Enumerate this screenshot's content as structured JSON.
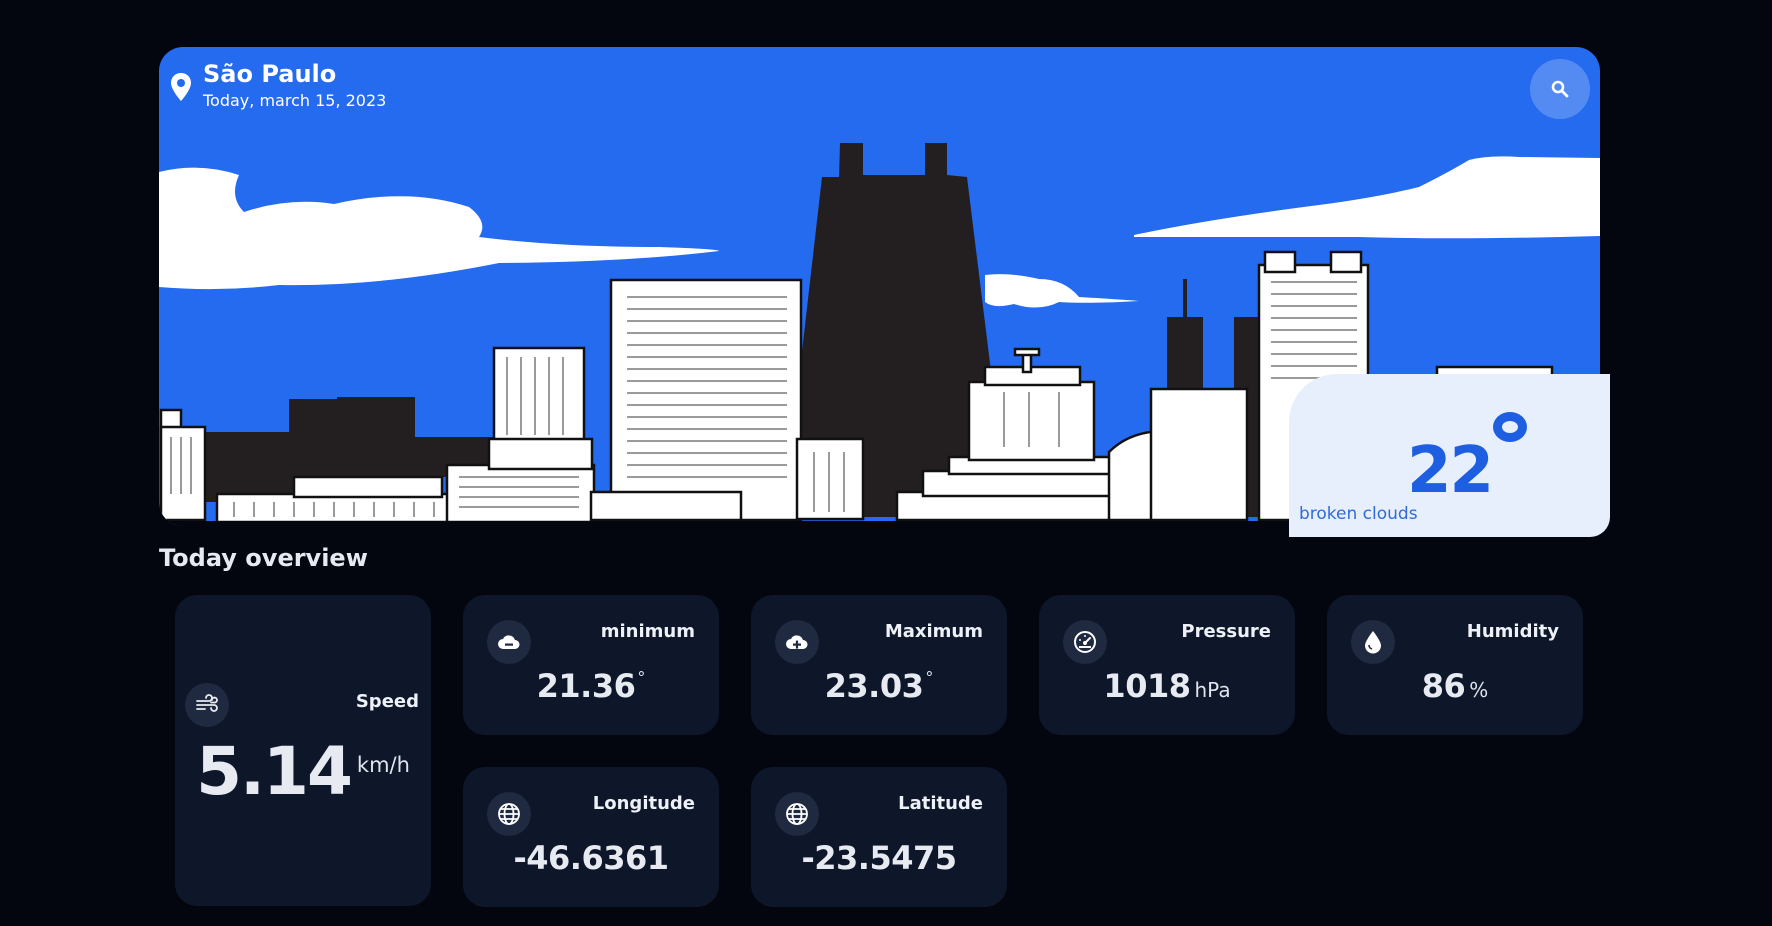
{
  "header": {
    "city": "São Paulo",
    "date": "Today, march 15, 2023",
    "icons": {
      "location": "location-pin-icon",
      "search": "search-icon"
    }
  },
  "weather": {
    "temperature": "22",
    "description": "broken clouds"
  },
  "overview": {
    "title": "Today overview",
    "speed": {
      "label": "Speed",
      "value": "5.14",
      "unit": "km/h",
      "icon": "wind-icon"
    },
    "minimum": {
      "label": "minimum",
      "value": "21.36",
      "unit": "°",
      "icon": "cloud-minus-icon"
    },
    "maximum": {
      "label": "Maximum",
      "value": "23.03",
      "unit": "°",
      "icon": "cloud-plus-icon"
    },
    "pressure": {
      "label": "Pressure",
      "value": "1018",
      "unit": "hPa",
      "icon": "gauge-icon"
    },
    "humidity": {
      "label": "Humidity",
      "value": "86",
      "unit": "%",
      "icon": "droplet-icon"
    },
    "longitude": {
      "label": "Longitude",
      "value": "-46.6361",
      "icon": "globe-icon"
    },
    "latitude": {
      "label": "Latitude",
      "value": "-23.5475",
      "icon": "globe-icon"
    }
  },
  "colors": {
    "background": "#03060f",
    "sky": "#256bf0",
    "card": "#0d1729",
    "accent": "#1d5fe0"
  }
}
